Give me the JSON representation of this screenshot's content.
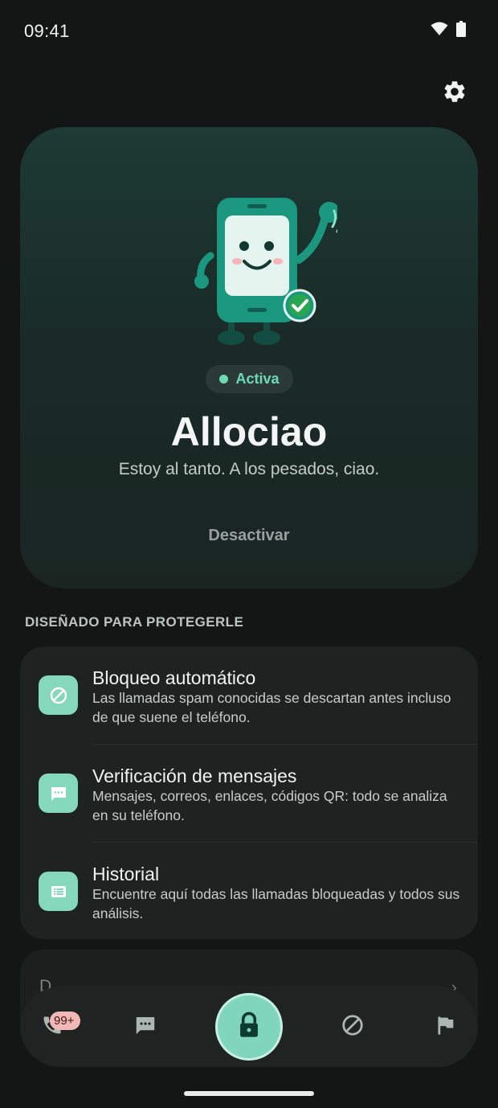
{
  "status_bar": {
    "time": "09:41"
  },
  "hero": {
    "status_label": "Activa",
    "title": "Allociao",
    "subtitle": "Estoy al tanto. A los pesados, ciao.",
    "deactivate_label": "Desactivar"
  },
  "section_header": "DISEÑADO PARA PROTEGERLE",
  "features": [
    {
      "icon": "block-icon",
      "title": "Bloqueo automático",
      "description": "Las llamadas spam conocidas se descartan antes incluso de que suene el teléfono."
    },
    {
      "icon": "message-icon",
      "title": "Verificación de mensajes",
      "description": "Mensajes, correos, enlaces, códigos QR: todo se analiza en su teléfono."
    },
    {
      "icon": "list-icon",
      "title": "Historial",
      "description": "Encuentre aquí todas las llamadas bloqueadas y todos sus análisis."
    }
  ],
  "more_card": {
    "label": "D"
  },
  "bottom_nav": {
    "calls_badge": "99+"
  },
  "colors": {
    "accent": "#7fd6bb",
    "background": "#141615",
    "card": "#1e2321",
    "badge": "#f2b8b5"
  }
}
